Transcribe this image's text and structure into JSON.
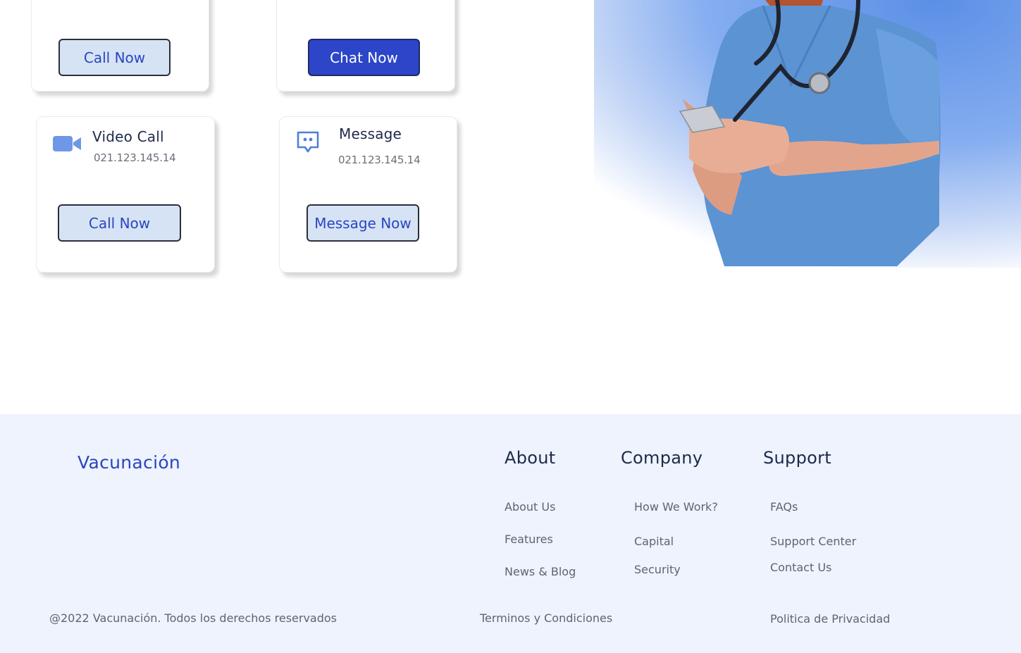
{
  "cards": {
    "call_top": {
      "button_label": "Call Now"
    },
    "chat_top": {
      "button_label": "Chat Now"
    },
    "video": {
      "title": "Video Call",
      "number": "021.123.145.14",
      "button_label": "Call Now",
      "icon": "video-camera-icon"
    },
    "message": {
      "title": "Message",
      "number": "021.123.145.14",
      "button_label": "Message Now",
      "icon": "chat-bubble-icon"
    }
  },
  "colors": {
    "accent": "#2c45c9",
    "light_button": "#d6e3f5",
    "footer_bg": "#eef3fd"
  },
  "footer": {
    "brand": "Vacunación",
    "columns": [
      {
        "heading": "About",
        "links": [
          "About Us",
          "Features",
          "News & Blog"
        ]
      },
      {
        "heading": "Company",
        "links": [
          "How We Work?",
          "Capital",
          "Security"
        ]
      },
      {
        "heading": "Support",
        "links": [
          "FAQs",
          "Support Center",
          "Contact Us"
        ]
      }
    ],
    "copyright": "@2022 Vacunación. Todos los derechos reservados",
    "terms": "Terminos y Condiciones",
    "privacy": "Politica de Privacidad"
  }
}
